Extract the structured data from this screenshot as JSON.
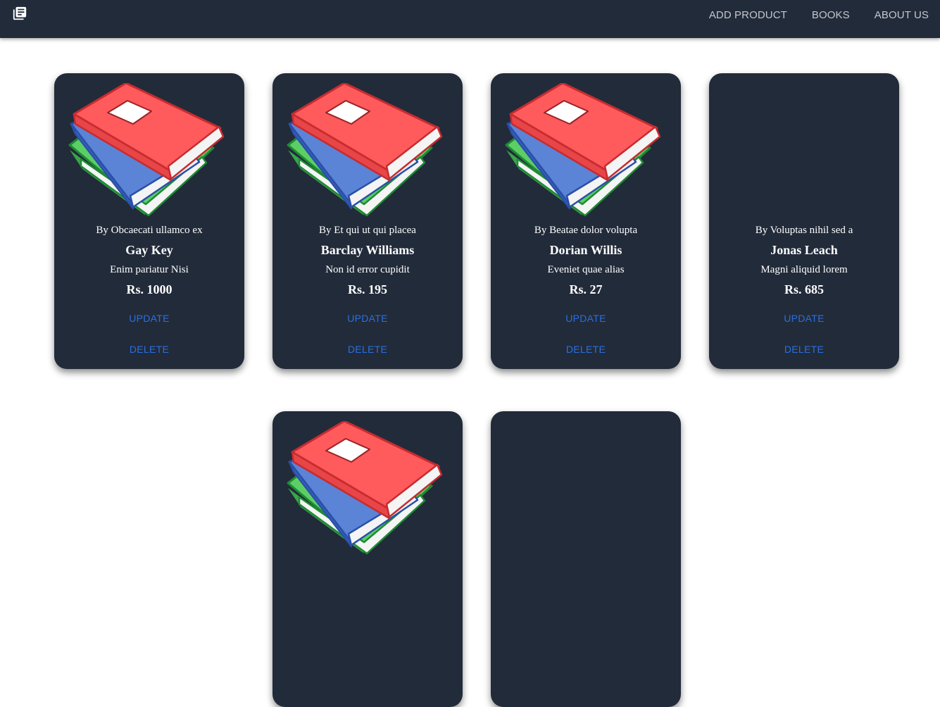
{
  "header": {
    "logo_icon": "library-books-icon",
    "nav": [
      {
        "label": "ADD PRODUCT"
      },
      {
        "label": "BOOKS"
      },
      {
        "label": "ABOUT US"
      }
    ]
  },
  "products": [
    {
      "author": "By Obcaecati ullamco ex",
      "title": "Gay Key",
      "description": "Enim pariatur Nisi",
      "price": "Rs. 1000",
      "update_label": "UPDATE",
      "delete_label": "DELETE",
      "has_image": true
    },
    {
      "author": "By Et qui ut qui placea",
      "title": "Barclay Williams",
      "description": "Non id error cupidit",
      "price": "Rs. 195",
      "update_label": "UPDATE",
      "delete_label": "DELETE",
      "has_image": true
    },
    {
      "author": "By Beatae dolor volupta",
      "title": "Dorian Willis",
      "description": "Eveniet quae alias",
      "price": "Rs. 27",
      "update_label": "UPDATE",
      "delete_label": "DELETE",
      "has_image": true
    },
    {
      "author": "By Voluptas nihil sed a",
      "title": "Jonas Leach",
      "description": "Magni aliquid lorem",
      "price": "Rs. 685",
      "update_label": "UPDATE",
      "delete_label": "DELETE",
      "has_image": false
    },
    {
      "has_image": true
    },
    {
      "has_image": false
    }
  ],
  "colors": {
    "appbar": "#222b3a",
    "card": "#222b3a",
    "button_text": "#2a6fe0",
    "nav_text": "#c4c7cd"
  }
}
